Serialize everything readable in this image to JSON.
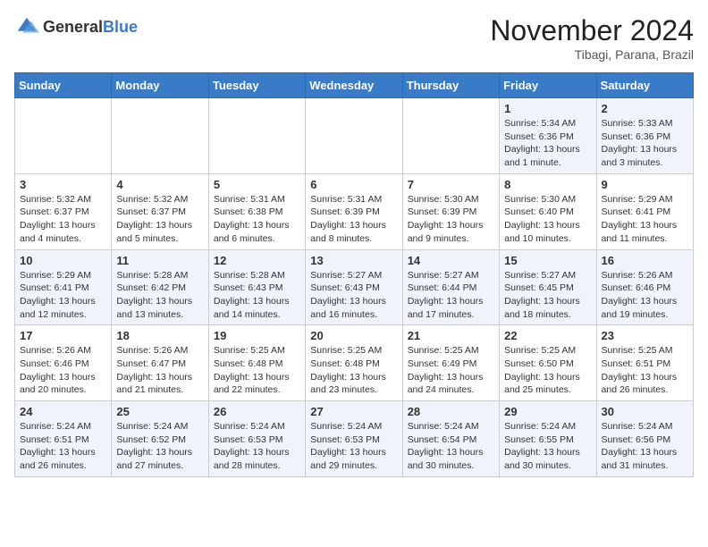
{
  "header": {
    "logo_general": "General",
    "logo_blue": "Blue",
    "month_year": "November 2024",
    "location": "Tibagi, Parana, Brazil"
  },
  "days_of_week": [
    "Sunday",
    "Monday",
    "Tuesday",
    "Wednesday",
    "Thursday",
    "Friday",
    "Saturday"
  ],
  "weeks": [
    [
      {
        "day": "",
        "sunrise": "",
        "sunset": "",
        "daylight": ""
      },
      {
        "day": "",
        "sunrise": "",
        "sunset": "",
        "daylight": ""
      },
      {
        "day": "",
        "sunrise": "",
        "sunset": "",
        "daylight": ""
      },
      {
        "day": "",
        "sunrise": "",
        "sunset": "",
        "daylight": ""
      },
      {
        "day": "",
        "sunrise": "",
        "sunset": "",
        "daylight": ""
      },
      {
        "day": "1",
        "sunrise": "Sunrise: 5:34 AM",
        "sunset": "Sunset: 6:36 PM",
        "daylight": "Daylight: 13 hours and 1 minute."
      },
      {
        "day": "2",
        "sunrise": "Sunrise: 5:33 AM",
        "sunset": "Sunset: 6:36 PM",
        "daylight": "Daylight: 13 hours and 3 minutes."
      }
    ],
    [
      {
        "day": "3",
        "sunrise": "Sunrise: 5:32 AM",
        "sunset": "Sunset: 6:37 PM",
        "daylight": "Daylight: 13 hours and 4 minutes."
      },
      {
        "day": "4",
        "sunrise": "Sunrise: 5:32 AM",
        "sunset": "Sunset: 6:37 PM",
        "daylight": "Daylight: 13 hours and 5 minutes."
      },
      {
        "day": "5",
        "sunrise": "Sunrise: 5:31 AM",
        "sunset": "Sunset: 6:38 PM",
        "daylight": "Daylight: 13 hours and 6 minutes."
      },
      {
        "day": "6",
        "sunrise": "Sunrise: 5:31 AM",
        "sunset": "Sunset: 6:39 PM",
        "daylight": "Daylight: 13 hours and 8 minutes."
      },
      {
        "day": "7",
        "sunrise": "Sunrise: 5:30 AM",
        "sunset": "Sunset: 6:39 PM",
        "daylight": "Daylight: 13 hours and 9 minutes."
      },
      {
        "day": "8",
        "sunrise": "Sunrise: 5:30 AM",
        "sunset": "Sunset: 6:40 PM",
        "daylight": "Daylight: 13 hours and 10 minutes."
      },
      {
        "day": "9",
        "sunrise": "Sunrise: 5:29 AM",
        "sunset": "Sunset: 6:41 PM",
        "daylight": "Daylight: 13 hours and 11 minutes."
      }
    ],
    [
      {
        "day": "10",
        "sunrise": "Sunrise: 5:29 AM",
        "sunset": "Sunset: 6:41 PM",
        "daylight": "Daylight: 13 hours and 12 minutes."
      },
      {
        "day": "11",
        "sunrise": "Sunrise: 5:28 AM",
        "sunset": "Sunset: 6:42 PM",
        "daylight": "Daylight: 13 hours and 13 minutes."
      },
      {
        "day": "12",
        "sunrise": "Sunrise: 5:28 AM",
        "sunset": "Sunset: 6:43 PM",
        "daylight": "Daylight: 13 hours and 14 minutes."
      },
      {
        "day": "13",
        "sunrise": "Sunrise: 5:27 AM",
        "sunset": "Sunset: 6:43 PM",
        "daylight": "Daylight: 13 hours and 16 minutes."
      },
      {
        "day": "14",
        "sunrise": "Sunrise: 5:27 AM",
        "sunset": "Sunset: 6:44 PM",
        "daylight": "Daylight: 13 hours and 17 minutes."
      },
      {
        "day": "15",
        "sunrise": "Sunrise: 5:27 AM",
        "sunset": "Sunset: 6:45 PM",
        "daylight": "Daylight: 13 hours and 18 minutes."
      },
      {
        "day": "16",
        "sunrise": "Sunrise: 5:26 AM",
        "sunset": "Sunset: 6:46 PM",
        "daylight": "Daylight: 13 hours and 19 minutes."
      }
    ],
    [
      {
        "day": "17",
        "sunrise": "Sunrise: 5:26 AM",
        "sunset": "Sunset: 6:46 PM",
        "daylight": "Daylight: 13 hours and 20 minutes."
      },
      {
        "day": "18",
        "sunrise": "Sunrise: 5:26 AM",
        "sunset": "Sunset: 6:47 PM",
        "daylight": "Daylight: 13 hours and 21 minutes."
      },
      {
        "day": "19",
        "sunrise": "Sunrise: 5:25 AM",
        "sunset": "Sunset: 6:48 PM",
        "daylight": "Daylight: 13 hours and 22 minutes."
      },
      {
        "day": "20",
        "sunrise": "Sunrise: 5:25 AM",
        "sunset": "Sunset: 6:48 PM",
        "daylight": "Daylight: 13 hours and 23 minutes."
      },
      {
        "day": "21",
        "sunrise": "Sunrise: 5:25 AM",
        "sunset": "Sunset: 6:49 PM",
        "daylight": "Daylight: 13 hours and 24 minutes."
      },
      {
        "day": "22",
        "sunrise": "Sunrise: 5:25 AM",
        "sunset": "Sunset: 6:50 PM",
        "daylight": "Daylight: 13 hours and 25 minutes."
      },
      {
        "day": "23",
        "sunrise": "Sunrise: 5:25 AM",
        "sunset": "Sunset: 6:51 PM",
        "daylight": "Daylight: 13 hours and 26 minutes."
      }
    ],
    [
      {
        "day": "24",
        "sunrise": "Sunrise: 5:24 AM",
        "sunset": "Sunset: 6:51 PM",
        "daylight": "Daylight: 13 hours and 26 minutes."
      },
      {
        "day": "25",
        "sunrise": "Sunrise: 5:24 AM",
        "sunset": "Sunset: 6:52 PM",
        "daylight": "Daylight: 13 hours and 27 minutes."
      },
      {
        "day": "26",
        "sunrise": "Sunrise: 5:24 AM",
        "sunset": "Sunset: 6:53 PM",
        "daylight": "Daylight: 13 hours and 28 minutes."
      },
      {
        "day": "27",
        "sunrise": "Sunrise: 5:24 AM",
        "sunset": "Sunset: 6:53 PM",
        "daylight": "Daylight: 13 hours and 29 minutes."
      },
      {
        "day": "28",
        "sunrise": "Sunrise: 5:24 AM",
        "sunset": "Sunset: 6:54 PM",
        "daylight": "Daylight: 13 hours and 30 minutes."
      },
      {
        "day": "29",
        "sunrise": "Sunrise: 5:24 AM",
        "sunset": "Sunset: 6:55 PM",
        "daylight": "Daylight: 13 hours and 30 minutes."
      },
      {
        "day": "30",
        "sunrise": "Sunrise: 5:24 AM",
        "sunset": "Sunset: 6:56 PM",
        "daylight": "Daylight: 13 hours and 31 minutes."
      }
    ]
  ]
}
